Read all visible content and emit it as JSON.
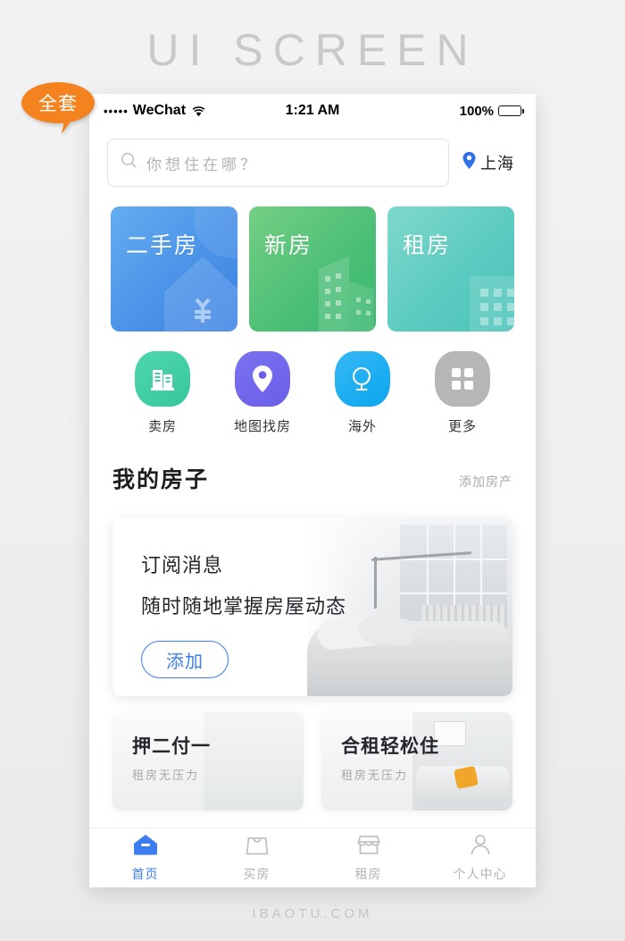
{
  "page": {
    "title": "UI SCREEN",
    "footer": "IBAOTU.COM",
    "badge": "全套",
    "badge_color": "#f3821f",
    "accent_color": "#3c7df0"
  },
  "statusbar": {
    "signal_dots": "•••••",
    "carrier": "WeChat",
    "wifi_icon": "wifi-icon",
    "time": "1:21 AM",
    "battery_percent": "100%",
    "battery_icon": "battery-full-icon"
  },
  "search": {
    "icon": "search-icon",
    "placeholder": "你想住在哪？",
    "location_icon": "location-pin-icon",
    "location": "上海"
  },
  "category_cards": [
    {
      "label": "二手房",
      "color": "#4b93e8",
      "deco": "house-yen-watermark"
    },
    {
      "label": "新房",
      "color": "#4ec077",
      "deco": "buildings-watermark"
    },
    {
      "label": "租房",
      "color": "#5ccbc0",
      "deco": "building-grid-watermark"
    }
  ],
  "quick_actions": [
    {
      "label": "卖房",
      "icon": "buildings-icon",
      "color": "#36c79c"
    },
    {
      "label": "地图找房",
      "icon": "map-pin-icon",
      "color": "#6a5ee8"
    },
    {
      "label": "海外",
      "icon": "globe-icon",
      "color": "#0aa5ee"
    },
    {
      "label": "更多",
      "icon": "grid-icon",
      "color": "#b6b6b6"
    }
  ],
  "section": {
    "title": "我的房子",
    "link": "添加房产"
  },
  "subscribe_card": {
    "title": "订阅消息",
    "subtitle": "随时随地掌握房屋动态",
    "button": "添加",
    "image": "bedroom-photo"
  },
  "promos": [
    {
      "title": "押二付一",
      "subtitle": "租房无压力",
      "image": "room-photo"
    },
    {
      "title": "合租轻松住",
      "subtitle": "租房无压力",
      "image": "living-room-photo"
    }
  ],
  "tabbar": [
    {
      "label": "首页",
      "icon": "home-icon",
      "active": true
    },
    {
      "label": "买房",
      "icon": "shopping-bag-icon",
      "active": false
    },
    {
      "label": "租房",
      "icon": "store-awning-icon",
      "active": false
    },
    {
      "label": "个人中心",
      "icon": "person-icon",
      "active": false
    }
  ]
}
